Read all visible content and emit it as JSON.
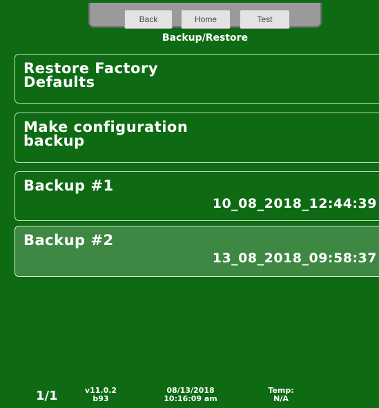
{
  "toolbar": {
    "back_label": "Back",
    "home_label": "Home",
    "test_label": "Test"
  },
  "page": {
    "title": "Backup/Restore"
  },
  "menu": {
    "items": [
      {
        "title": "Restore Factory\nDefaults"
      },
      {
        "title": "Make configuration\nbackup"
      },
      {
        "title": "Backup #1",
        "date": "10_08_2018_12:44:39"
      },
      {
        "title": "Backup #2",
        "date": "13_08_2018_09:58:37",
        "selected": true
      }
    ]
  },
  "status_bar": {
    "page": "1/1",
    "version": "v11.0.2",
    "build": "b93",
    "date": "08/13/2018",
    "time": "10:16:09 am",
    "temp_label": "Temp:",
    "temp_value": "N/A"
  },
  "colors": {
    "background": "#0e6b14",
    "selected_item": "#3f8843",
    "toolbar": "#9a9a9a"
  }
}
